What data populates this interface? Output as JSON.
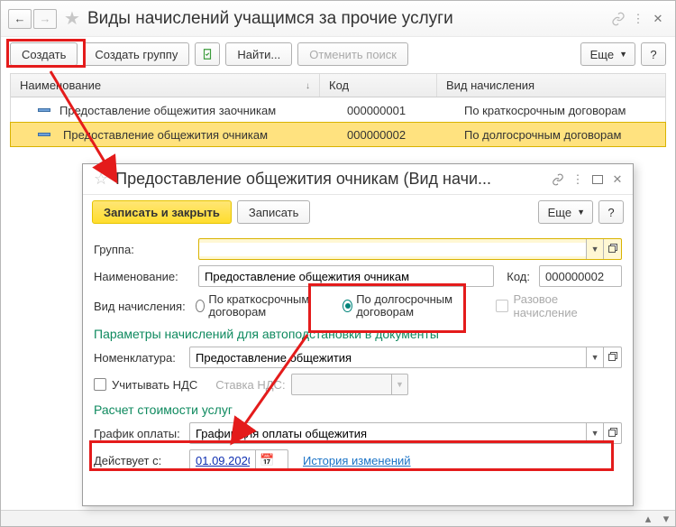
{
  "title": "Виды начислений учащимся за прочие услуги",
  "toolbar": {
    "create": "Создать",
    "create_group": "Создать группу",
    "find": "Найти...",
    "cancel_search": "Отменить поиск",
    "more": "Еще",
    "help": "?"
  },
  "grid": {
    "col_name": "Наименование",
    "col_code": "Код",
    "col_type": "Вид начисления",
    "rows": [
      {
        "name": "Предоставление общежития заочникам",
        "code": "000000001",
        "type": "По краткосрочным договорам"
      },
      {
        "name": "Предоставление общежития очникам",
        "code": "000000002",
        "type": "По долгосрочным договорам"
      }
    ]
  },
  "dialog": {
    "title": "Предоставление общежития очникам (Вид начи...",
    "save_close": "Записать и закрыть",
    "save": "Записать",
    "more": "Еще",
    "help": "?",
    "group_label": "Группа:",
    "group_value": "",
    "name_label": "Наименование:",
    "name_value": "Предоставление общежития очникам",
    "code_label": "Код:",
    "code_value": "000000002",
    "type_label": "Вид начисления:",
    "type_opt_short": "По краткосрочным договорам",
    "type_opt_long": "По долгосрочным договорам",
    "onetime_label": "Разовое начисление",
    "section_params": "Параметры начислений для автоподстановки в документы",
    "nomen_label": "Номенклатура:",
    "nomen_value": "Предоставление общежития",
    "vat_chk": "Учитывать НДС",
    "vat_rate_label": "Ставка НДС:",
    "section_cost": "Расчет стоимости услуг",
    "pay_sched_label": "График оплаты:",
    "pay_sched_value": "График для оплаты общежития",
    "effective_label": "Действует с:",
    "effective_date": "01.09.2020",
    "history_link": "История изменений"
  }
}
